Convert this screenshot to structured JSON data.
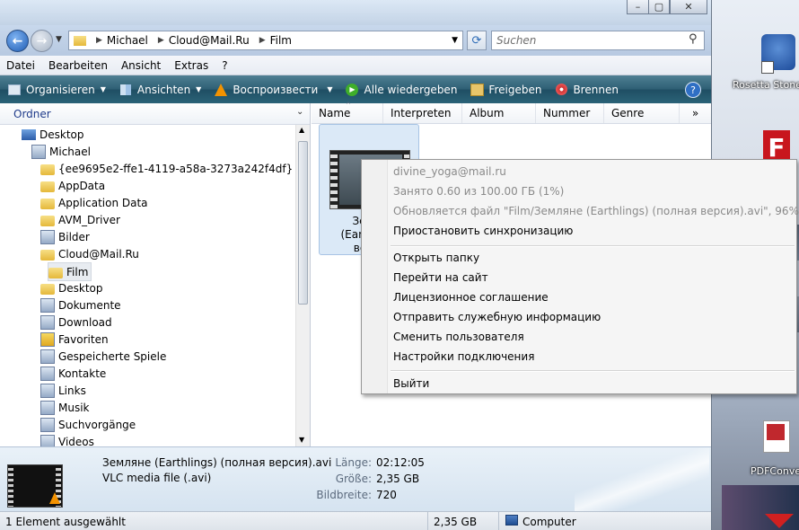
{
  "explorer": {
    "address": {
      "segments": [
        "Michael",
        "Cloud@Mail.Ru",
        "Film"
      ]
    },
    "search": {
      "placeholder": "Suchen"
    },
    "menu": [
      "Datei",
      "Bearbeiten",
      "Ansicht",
      "Extras",
      "?"
    ],
    "toolbar": {
      "organize": "Organisieren",
      "views": "Ansichten",
      "play_vlc": "Воспроизвести",
      "play_all": "Alle wiedergeben",
      "share": "Freigeben",
      "burn": "Brennen"
    },
    "nav": {
      "header": "Ordner",
      "items": [
        "Desktop",
        "Michael",
        "{ee9695e2-ffe1-4119-a58a-3273a242f4df}",
        "AppData",
        "Application Data",
        "AVM_Driver",
        "Bilder",
        "Cloud@Mail.Ru",
        "Film",
        "Desktop",
        "Dokumente",
        "Download",
        "Favoriten",
        "Gespeicherte Spiele",
        "Kontakte",
        "Links",
        "Musik",
        "Suchvorgänge",
        "Videos"
      ]
    },
    "columns": [
      "Name",
      "Interpreten",
      "Album",
      "Nummer",
      "Genre",
      "»"
    ],
    "file": {
      "label_lines": [
        "Земля",
        "(Earthlings",
        "верси"
      ]
    },
    "details": {
      "name": "Земляне (Earthlings) (полная версия).avi",
      "type": "VLC media file (.avi)",
      "fields": [
        {
          "label": "Länge:",
          "value": "02:12:05"
        },
        {
          "label": "Größe:",
          "value": "2,35 GB"
        },
        {
          "label": "Bildbreite:",
          "value": "720"
        }
      ]
    },
    "status": {
      "selection": "1 Element ausgewählt",
      "size": "2,35 GB",
      "location": "Computer"
    }
  },
  "context_menu": {
    "account": "divine_yoga@mail.ru",
    "usage": "Занято 0.60 из 100.00 ГБ (1%)",
    "sync_status": "Обновляется файл \"Film/Земляне (Earthlings) (полная версия).avi\", 96%",
    "pause": "Приостановить синхронизацию",
    "items": [
      "Открыть папку",
      "Перейти на сайт",
      "Лицензионное соглашение",
      "Отправить служебную информацию",
      "Сменить пользователя",
      "Настройки подключения"
    ],
    "exit": "Выйти"
  },
  "desktop": {
    "icons": [
      "Rosetta Stone 3",
      "PDFConve"
    ]
  }
}
